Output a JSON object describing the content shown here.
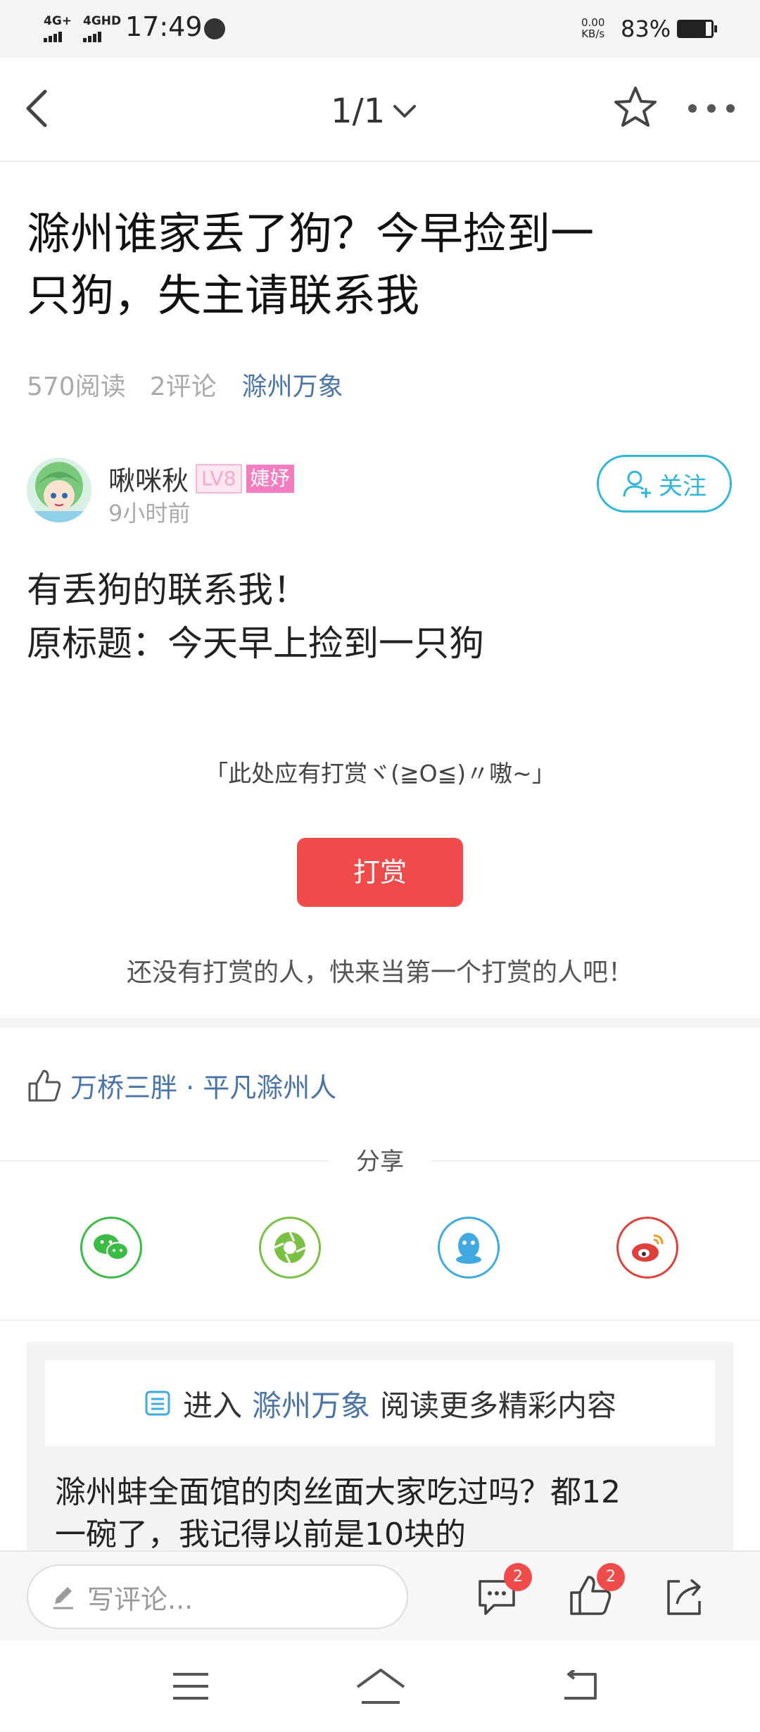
{
  "status_bar": {
    "net1": "4G+",
    "net2": "4GHD",
    "time": "17:49",
    "speed_value": "0.00",
    "speed_unit": "KB/s",
    "battery": "83%",
    "battery_level": 0.83
  },
  "nav": {
    "page_indicator": "1/1"
  },
  "post": {
    "title_line1": "滁州谁家丢了狗？今早捡到一",
    "title_line2": "只狗，失主请联系我",
    "reads": "570阅读",
    "comments": "2评论",
    "channel": "滁州万象"
  },
  "author": {
    "name": "啾咪秋",
    "level": "LV8",
    "tag": "婕妤",
    "time": "9小时前",
    "follow_label": "关注"
  },
  "content": {
    "line1": "有丢狗的联系我！",
    "line2": "原标题：今天早上捡到一只狗"
  },
  "reward": {
    "prompt": "「此处应有打赏ヾ(≧O≦)〃嗷~」",
    "button_label": "打赏",
    "empty_text": "还没有打赏的人，快来当第一个打赏的人吧！"
  },
  "likes": {
    "users": "万桥三胖 · 平凡滁州人"
  },
  "share": {
    "label": "分享",
    "targets": [
      "wechat-icon",
      "moments-icon",
      "qq-icon",
      "weibo-icon"
    ]
  },
  "more": {
    "prefix": "进入",
    "channel": "滁州万象",
    "suffix": "阅读更多精彩内容",
    "related_line1": "滁州蚌全面馆的肉丝面大家吃过吗？都12",
    "related_line2": "一碗了，我记得以前是10块的"
  },
  "bottom_bar": {
    "comment_placeholder": "写评论...",
    "comment_count": "2",
    "like_count": "2"
  },
  "colors": {
    "accent_blue": "#4a74a8",
    "follow_cyan": "#2fb6d8",
    "reward_red": "#ef4b4b",
    "wechat_green": "#3dbb47",
    "moments_green": "#7ac143",
    "qq_blue": "#3fa9e0",
    "weibo_red": "#e0403c"
  }
}
